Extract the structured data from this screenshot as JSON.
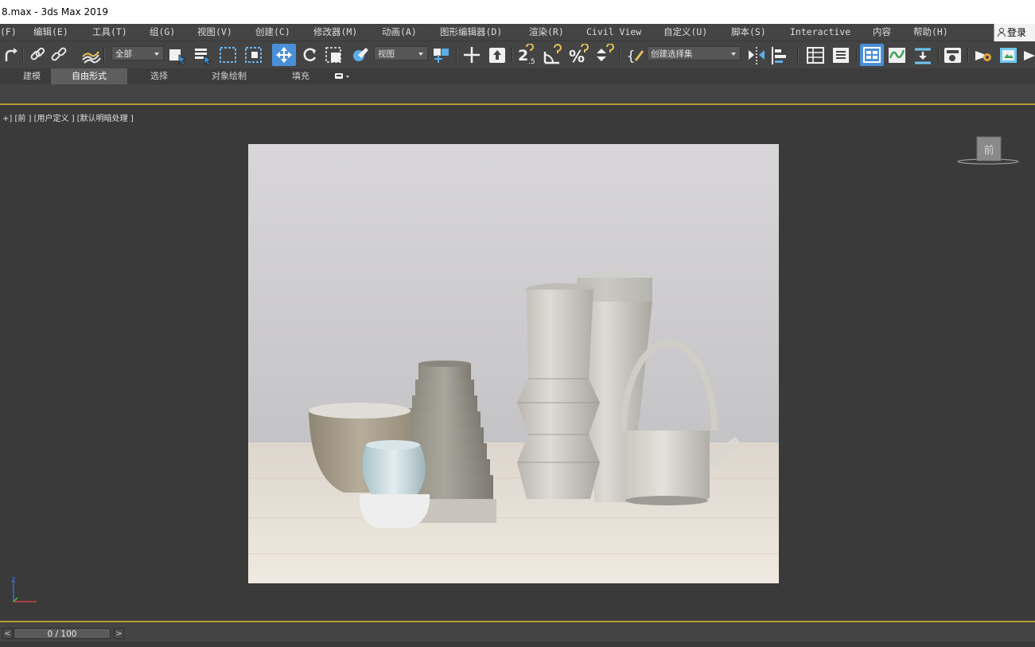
{
  "window": {
    "title": "8.max - 3ds Max 2019"
  },
  "menubar": {
    "items": [
      {
        "label": "(F)"
      },
      {
        "label": "编辑(E)"
      },
      {
        "label": "工具(T)"
      },
      {
        "label": "组(G)"
      },
      {
        "label": "视图(V)"
      },
      {
        "label": "创建(C)"
      },
      {
        "label": "修改器(M)"
      },
      {
        "label": "动画(A)"
      },
      {
        "label": "图形编辑器(D)"
      },
      {
        "label": "渲染(R)"
      },
      {
        "label": "Civil View"
      },
      {
        "label": "自定义(U)"
      },
      {
        "label": "脚本(S)"
      },
      {
        "label": "Interactive"
      },
      {
        "label": "内容"
      },
      {
        "label": "帮助(H)"
      }
    ],
    "login_label": "登录"
  },
  "toolbar": {
    "selection_filter": "全部",
    "ref_coord": "视图",
    "named_selection": "创建选择集",
    "icons": [
      "redo-icon",
      "link-icon",
      "unlink-icon",
      "bind-spacewarp-icon",
      "select-object-icon",
      "select-by-name-icon",
      "rect-selection-icon",
      "window-crossing-icon",
      "select-move-icon",
      "select-rotate-icon",
      "select-scale-icon",
      "select-place-icon",
      "use-pivot-icon",
      "select-manipulate-icon",
      "keyboard-shortcut-icon",
      "snap-toggle-icon",
      "angle-snap-icon",
      "percent-snap-icon",
      "spinner-snap-icon",
      "edit-named-selection-icon",
      "mirror-icon",
      "align-icon",
      "scene-explorer-icon",
      "layer-explorer-icon",
      "toggle-ribbon-icon",
      "curve-editor-icon",
      "schematic-view-icon",
      "material-editor-icon",
      "render-setup-icon",
      "render-frame-icon",
      "render-icon"
    ]
  },
  "ribbon": {
    "tabs": [
      "建模",
      "自由形式",
      "选择",
      "对象绘制",
      "填充"
    ],
    "active_tab": "自由形式"
  },
  "viewport": {
    "label": "+] [前 ] [用户定义 ] [默认明暗处理 ]",
    "viewcube_label": "前",
    "axis_label": "Z"
  },
  "timeline": {
    "frame_display": "0 / 100",
    "prev": "<",
    "next": ">"
  },
  "colors": {
    "accent_highlight": "#b59a35",
    "active_tool": "#4a90d9"
  }
}
